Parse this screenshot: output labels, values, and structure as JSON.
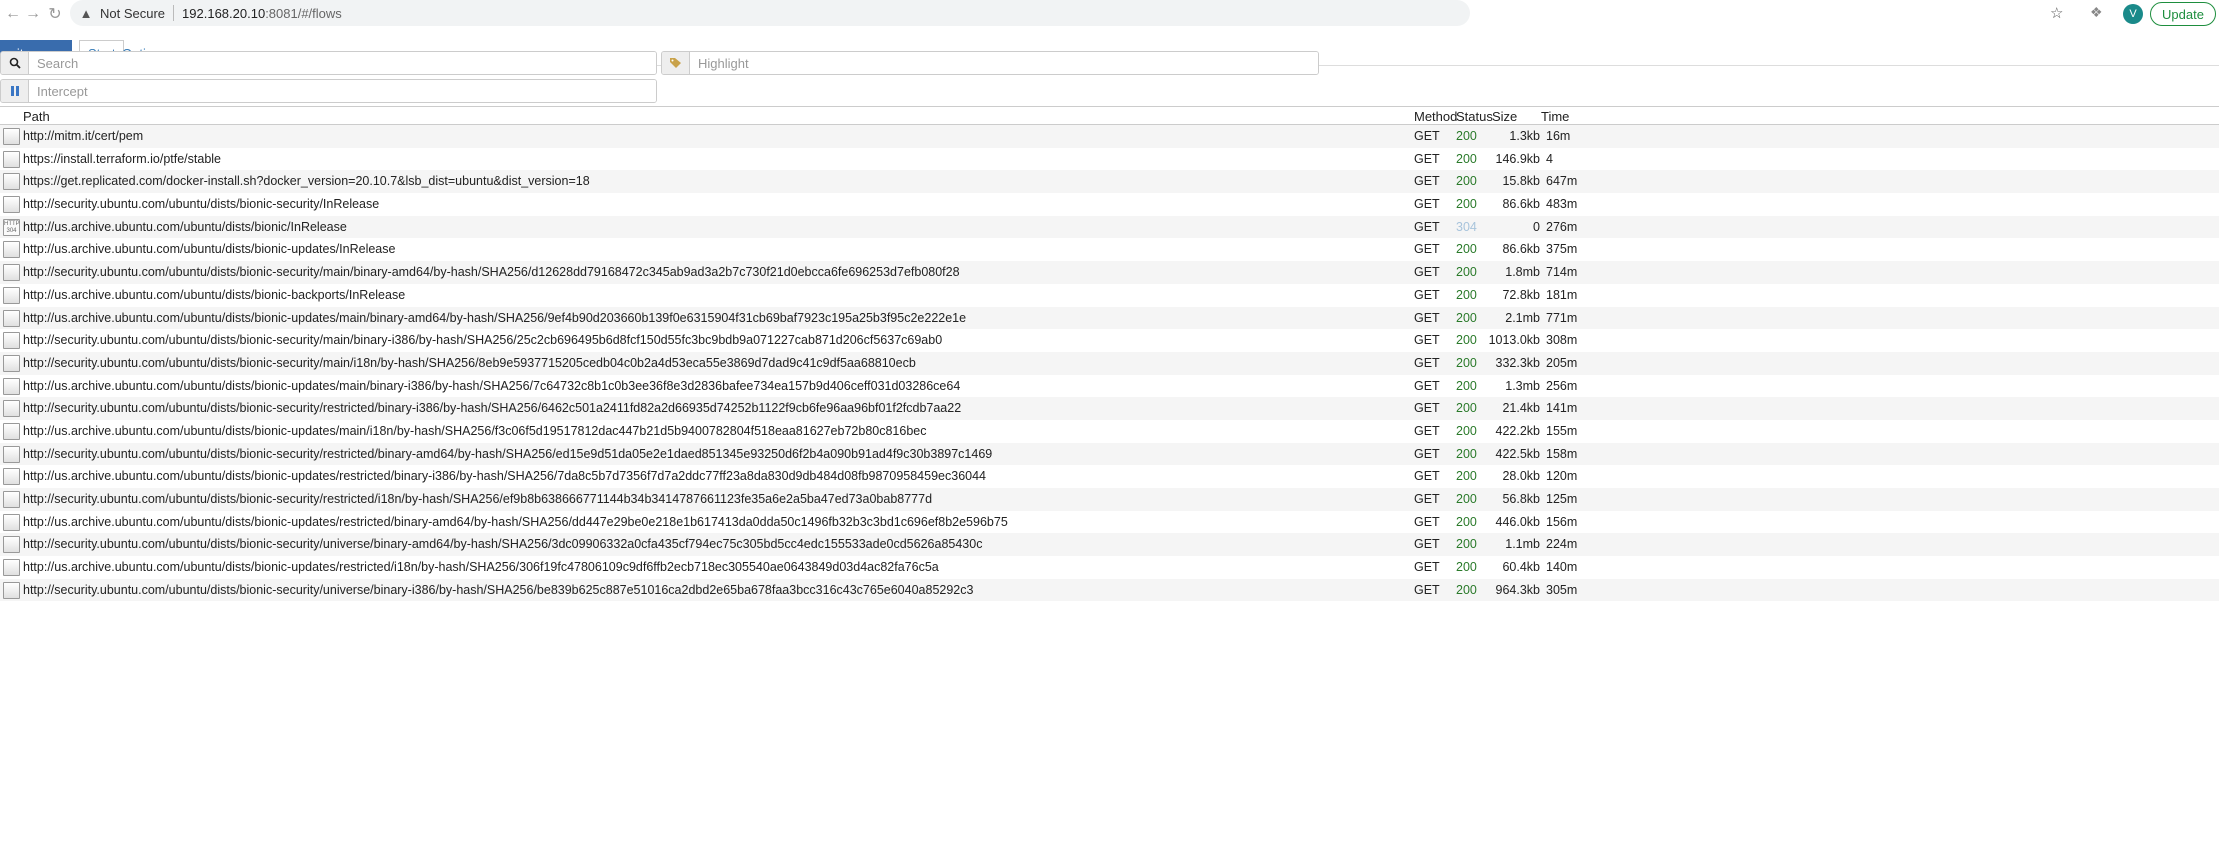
{
  "browser": {
    "not_secure": "Not Secure",
    "url_host": "192.168.20.10",
    "url_rest": ":8081/#/flows",
    "avatar_letter": "V",
    "update_label": "Update"
  },
  "menu": {
    "brand": "mitmproxy",
    "tabs": [
      "Start",
      "Options"
    ]
  },
  "filters": {
    "search_placeholder": "Search",
    "highlight_placeholder": "Highlight",
    "intercept_placeholder": "Intercept"
  },
  "table": {
    "headers": {
      "path": "Path",
      "method": "Method",
      "status": "Status",
      "size": "Size",
      "time": "Time"
    },
    "rows": [
      {
        "path": "http://mitm.it/cert/pem",
        "method": "GET",
        "status": "200",
        "size": "1.3kb",
        "time": "16m"
      },
      {
        "path": "https://install.terraform.io/ptfe/stable",
        "method": "GET",
        "status": "200",
        "size": "146.9kb",
        "time": "4"
      },
      {
        "path": "https://get.replicated.com/docker-install.sh?docker_version=20.10.7&lsb_dist=ubuntu&dist_version=18",
        "method": "GET",
        "status": "200",
        "size": "15.8kb",
        "time": "647m"
      },
      {
        "path": "http://security.ubuntu.com/ubuntu/dists/bionic-security/InRelease",
        "method": "GET",
        "status": "200",
        "size": "86.6kb",
        "time": "483m"
      },
      {
        "path": "http://us.archive.ubuntu.com/ubuntu/dists/bionic/InRelease",
        "method": "GET",
        "status": "304",
        "size": "0",
        "time": "276m",
        "not_modified": true
      },
      {
        "path": "http://us.archive.ubuntu.com/ubuntu/dists/bionic-updates/InRelease",
        "method": "GET",
        "status": "200",
        "size": "86.6kb",
        "time": "375m"
      },
      {
        "path": "http://security.ubuntu.com/ubuntu/dists/bionic-security/main/binary-amd64/by-hash/SHA256/d12628dd79168472c345ab9ad3a2b7c730f21d0ebcca6fe696253d7efb080f28",
        "method": "GET",
        "status": "200",
        "size": "1.8mb",
        "time": "714m"
      },
      {
        "path": "http://us.archive.ubuntu.com/ubuntu/dists/bionic-backports/InRelease",
        "method": "GET",
        "status": "200",
        "size": "72.8kb",
        "time": "181m"
      },
      {
        "path": "http://us.archive.ubuntu.com/ubuntu/dists/bionic-updates/main/binary-amd64/by-hash/SHA256/9ef4b90d203660b139f0e6315904f31cb69baf7923c195a25b3f95c2e222e1e",
        "method": "GET",
        "status": "200",
        "size": "2.1mb",
        "time": "771m"
      },
      {
        "path": "http://security.ubuntu.com/ubuntu/dists/bionic-security/main/binary-i386/by-hash/SHA256/25c2cb696495b6d8fcf150d55fc3bc9bdb9a071227cab871d206cf5637c69ab0",
        "method": "GET",
        "status": "200",
        "size": "1013.0kb",
        "time": "308m"
      },
      {
        "path": "http://security.ubuntu.com/ubuntu/dists/bionic-security/main/i18n/by-hash/SHA256/8eb9e5937715205cedb04c0b2a4d53eca55e3869d7dad9c41c9df5aa68810ecb",
        "method": "GET",
        "status": "200",
        "size": "332.3kb",
        "time": "205m"
      },
      {
        "path": "http://us.archive.ubuntu.com/ubuntu/dists/bionic-updates/main/binary-i386/by-hash/SHA256/7c64732c8b1c0b3ee36f8e3d2836bafee734ea157b9d406ceff031d03286ce64",
        "method": "GET",
        "status": "200",
        "size": "1.3mb",
        "time": "256m"
      },
      {
        "path": "http://security.ubuntu.com/ubuntu/dists/bionic-security/restricted/binary-i386/by-hash/SHA256/6462c501a2411fd82a2d66935d74252b1122f9cb6fe96aa96bf01f2fcdb7aa22",
        "method": "GET",
        "status": "200",
        "size": "21.4kb",
        "time": "141m"
      },
      {
        "path": "http://us.archive.ubuntu.com/ubuntu/dists/bionic-updates/main/i18n/by-hash/SHA256/f3c06f5d19517812dac447b21d5b9400782804f518eaa81627eb72b80c816bec",
        "method": "GET",
        "status": "200",
        "size": "422.2kb",
        "time": "155m"
      },
      {
        "path": "http://security.ubuntu.com/ubuntu/dists/bionic-security/restricted/binary-amd64/by-hash/SHA256/ed15e9d51da05e2e1daed851345e93250d6f2b4a090b91ad4f9c30b3897c1469",
        "method": "GET",
        "status": "200",
        "size": "422.5kb",
        "time": "158m"
      },
      {
        "path": "http://us.archive.ubuntu.com/ubuntu/dists/bionic-updates/restricted/binary-i386/by-hash/SHA256/7da8c5b7d7356f7d7a2ddc77ff23a8da830d9db484d08fb9870958459ec36044",
        "method": "GET",
        "status": "200",
        "size": "28.0kb",
        "time": "120m"
      },
      {
        "path": "http://security.ubuntu.com/ubuntu/dists/bionic-security/restricted/i18n/by-hash/SHA256/ef9b8b638666771144b34b3414787661123fe35a6e2a5ba47ed73a0bab8777d",
        "method": "GET",
        "status": "200",
        "size": "56.8kb",
        "time": "125m"
      },
      {
        "path": "http://us.archive.ubuntu.com/ubuntu/dists/bionic-updates/restricted/binary-amd64/by-hash/SHA256/dd447e29be0e218e1b617413da0dda50c1496fb32b3c3bd1c696ef8b2e596b75",
        "method": "GET",
        "status": "200",
        "size": "446.0kb",
        "time": "156m"
      },
      {
        "path": "http://security.ubuntu.com/ubuntu/dists/bionic-security/universe/binary-amd64/by-hash/SHA256/3dc09906332a0cfa435cf794ec75c305bd5cc4edc155533ade0cd5626a85430c",
        "method": "GET",
        "status": "200",
        "size": "1.1mb",
        "time": "224m"
      },
      {
        "path": "http://us.archive.ubuntu.com/ubuntu/dists/bionic-updates/restricted/i18n/by-hash/SHA256/306f19fc47806109c9df6ffb2ecb718ec305540ae0643849d03d4ac82fa76c5a",
        "method": "GET",
        "status": "200",
        "size": "60.4kb",
        "time": "140m"
      },
      {
        "path": "http://security.ubuntu.com/ubuntu/dists/bionic-security/universe/binary-i386/by-hash/SHA256/be839b625c887e51016ca2dbd2e65ba678faa3bcc316c43c765e6040a85292c3",
        "method": "GET",
        "status": "200",
        "size": "964.3kb",
        "time": "305m"
      }
    ]
  }
}
